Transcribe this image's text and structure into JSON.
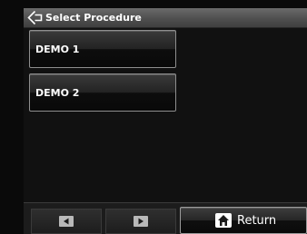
{
  "title_bar": {
    "icon": "back-arrow-icon",
    "title": "Select Procedure"
  },
  "procedures": [
    {
      "label": "DEMO 1"
    },
    {
      "label": "DEMO 2"
    }
  ],
  "bottom_bar": {
    "prev_icon": "arrow-left-icon",
    "next_icon": "arrow-right-icon",
    "return_icon": "home-icon",
    "return_label": "Return"
  },
  "colors": {
    "background": "#111111",
    "title_bar": "#555555",
    "text": "#ffffff",
    "arrow_buttons": "#b9b9b9"
  }
}
